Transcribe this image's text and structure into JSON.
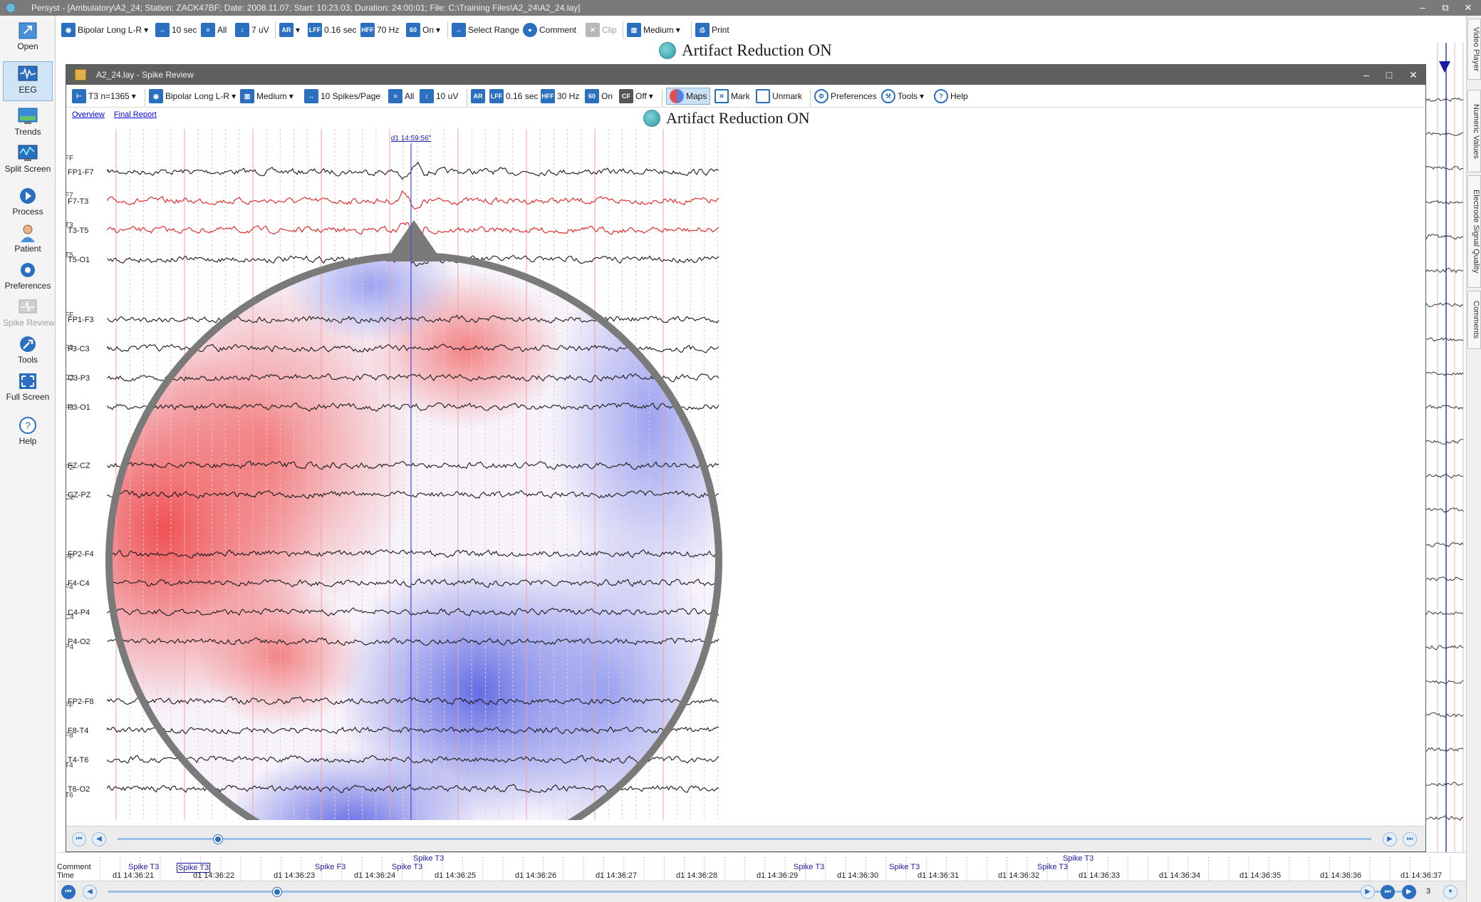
{
  "app": {
    "title": "Persyst - [Ambulatory\\A2_24; Station: ZACK47BF; Date: 2008.11.07; Start: 10:23.03; Duration: 24:00:01; File: C:\\Training Files\\A2_24\\A2_24.lay]",
    "window_controls": [
      "–",
      "⧉",
      "✕"
    ]
  },
  "sidebar": {
    "items": [
      {
        "label": "Open",
        "icon": "open-icon"
      },
      {
        "label": "EEG",
        "icon": "eeg-icon"
      },
      {
        "label": "Trends",
        "icon": "trends-icon"
      },
      {
        "label": "Split Screen",
        "icon": "split-screen-icon"
      },
      {
        "label": "Process",
        "icon": "process-icon"
      },
      {
        "label": "Patient",
        "icon": "patient-icon"
      },
      {
        "label": "Preferences",
        "icon": "gear-icon"
      },
      {
        "label": "Spike Review",
        "icon": "spike-review-icon"
      },
      {
        "label": "Tools",
        "icon": "tools-icon"
      },
      {
        "label": "Full Screen",
        "icon": "fullscreen-icon"
      },
      {
        "label": "Help",
        "icon": "help-icon"
      }
    ]
  },
  "main_toolbar": {
    "montage": "Bipolar Long L-R",
    "timebase": "10 sec",
    "all": "All",
    "sensitivity": "7 uV",
    "ar_icon": "AR",
    "lff_icon": "LFF",
    "lff": "0.16 sec",
    "hff_icon": "HFF",
    "hff": "70 Hz",
    "notch_icon": "60",
    "notch": "On",
    "select_range": "Select Range",
    "comment": "Comment",
    "clip": "Clip",
    "medium": "Medium",
    "print": "Print"
  },
  "artifact_banner": "Artifact Reduction ON",
  "right_tabs": [
    "Video Player",
    "Numeric Values",
    "Electrode Signal Quality",
    "Comments"
  ],
  "spike_review": {
    "title": "A2_24.lay - Spike Review",
    "toolbar": {
      "spike_select": "T3 n=1365",
      "montage": "Bipolar Long L-R",
      "medium": "Medium",
      "spikes_per_page": "10 Spikes/Page",
      "all": "All",
      "sensitivity": "10 uV",
      "ar_icon": "AR",
      "lff_icon": "LFF",
      "lff": "0.16 sec",
      "hff_icon": "HFF",
      "hff": "30 Hz",
      "notch_icon": "60",
      "notch": "On",
      "cf_icon": "CF",
      "cf": "Off",
      "maps": "Maps",
      "mark": "Mark",
      "unmark": "Unmark",
      "preferences": "Preferences",
      "tools": "Tools",
      "help": "Help"
    },
    "links": [
      "Overview",
      "Final Report"
    ],
    "banner": "Artifact Reduction ON",
    "cursor_time": "d1 14:59:56\"",
    "channels": [
      {
        "label": "FP1-F7",
        "color": "#1a1a1a"
      },
      {
        "label": "F7-T3",
        "color": "#e02020"
      },
      {
        "label": "T3-T5",
        "color": "#e02020"
      },
      {
        "label": "T5-O1",
        "color": "#1a1a1a"
      },
      {
        "label": "FP1-F3",
        "color": "#1a1a1a"
      },
      {
        "label": "F3-C3",
        "color": "#1a1a1a"
      },
      {
        "label": "C3-P3",
        "color": "#1a1a1a"
      },
      {
        "label": "P3-O1",
        "color": "#1a1a1a"
      },
      {
        "label": "FZ-CZ",
        "color": "#1a1a1a"
      },
      {
        "label": "CZ-PZ",
        "color": "#1a1a1a"
      },
      {
        "label": "FP2-F4",
        "color": "#1a1a1a"
      },
      {
        "label": "F4-C4",
        "color": "#1a1a1a"
      },
      {
        "label": "C4-P4",
        "color": "#1a1a1a"
      },
      {
        "label": "P4-O2",
        "color": "#1a1a1a"
      },
      {
        "label": "FP2-F8",
        "color": "#1a1a1a"
      },
      {
        "label": "F8-T4",
        "color": "#1a1a1a"
      },
      {
        "label": "T4-T6",
        "color": "#1a1a1a"
      },
      {
        "label": "T6-O2",
        "color": "#1a1a1a"
      }
    ],
    "left_edge_labels": [
      "FF",
      "F7",
      "T3",
      "T5",
      "FF",
      "F3",
      "C3",
      "P3",
      "F2",
      "C2",
      "FF",
      "F4",
      "C4",
      "P4",
      "FF",
      "F8",
      "T4",
      "T6"
    ],
    "scroll_position": 0.08
  },
  "comment_strip": {
    "row_labels": [
      "Comment",
      "Time"
    ],
    "spikes": [
      {
        "label": "Spike T3",
        "boxed": false,
        "row": 0
      },
      {
        "label": "Spike T3",
        "boxed": true,
        "row": 0
      },
      {
        "label": "Spike F3",
        "boxed": false,
        "row": 0
      },
      {
        "label": "Spike T3",
        "boxed": false,
        "row": 0
      },
      {
        "label": "Spike T3",
        "boxed": false,
        "row": -1
      },
      {
        "label": "Spike T3",
        "boxed": false,
        "row": 0
      },
      {
        "label": "Spike T3",
        "boxed": false,
        "row": 0
      },
      {
        "label": "Spike T3",
        "boxed": false,
        "row": 0
      },
      {
        "label": "Spike T3",
        "boxed": false,
        "row": -1
      }
    ],
    "times": [
      "d1 14:36:21",
      "d1 14:36:22",
      "d1 14:36:23",
      "d1 14:36:24",
      "d1 14:36:25",
      "d1 14:36:26",
      "d1 14:36:27",
      "d1 14:36:28",
      "d1 14:36:29",
      "d1 14:36:30",
      "d1 14:36:31",
      "d1 14:36:32",
      "d1 14:36:33",
      "d1 14:36:34",
      "d1 14:36:35",
      "d1 14:36:36",
      "d1 14:36:37"
    ]
  },
  "bottom_nav": {
    "page": "3",
    "scroll_position": 0.13
  }
}
